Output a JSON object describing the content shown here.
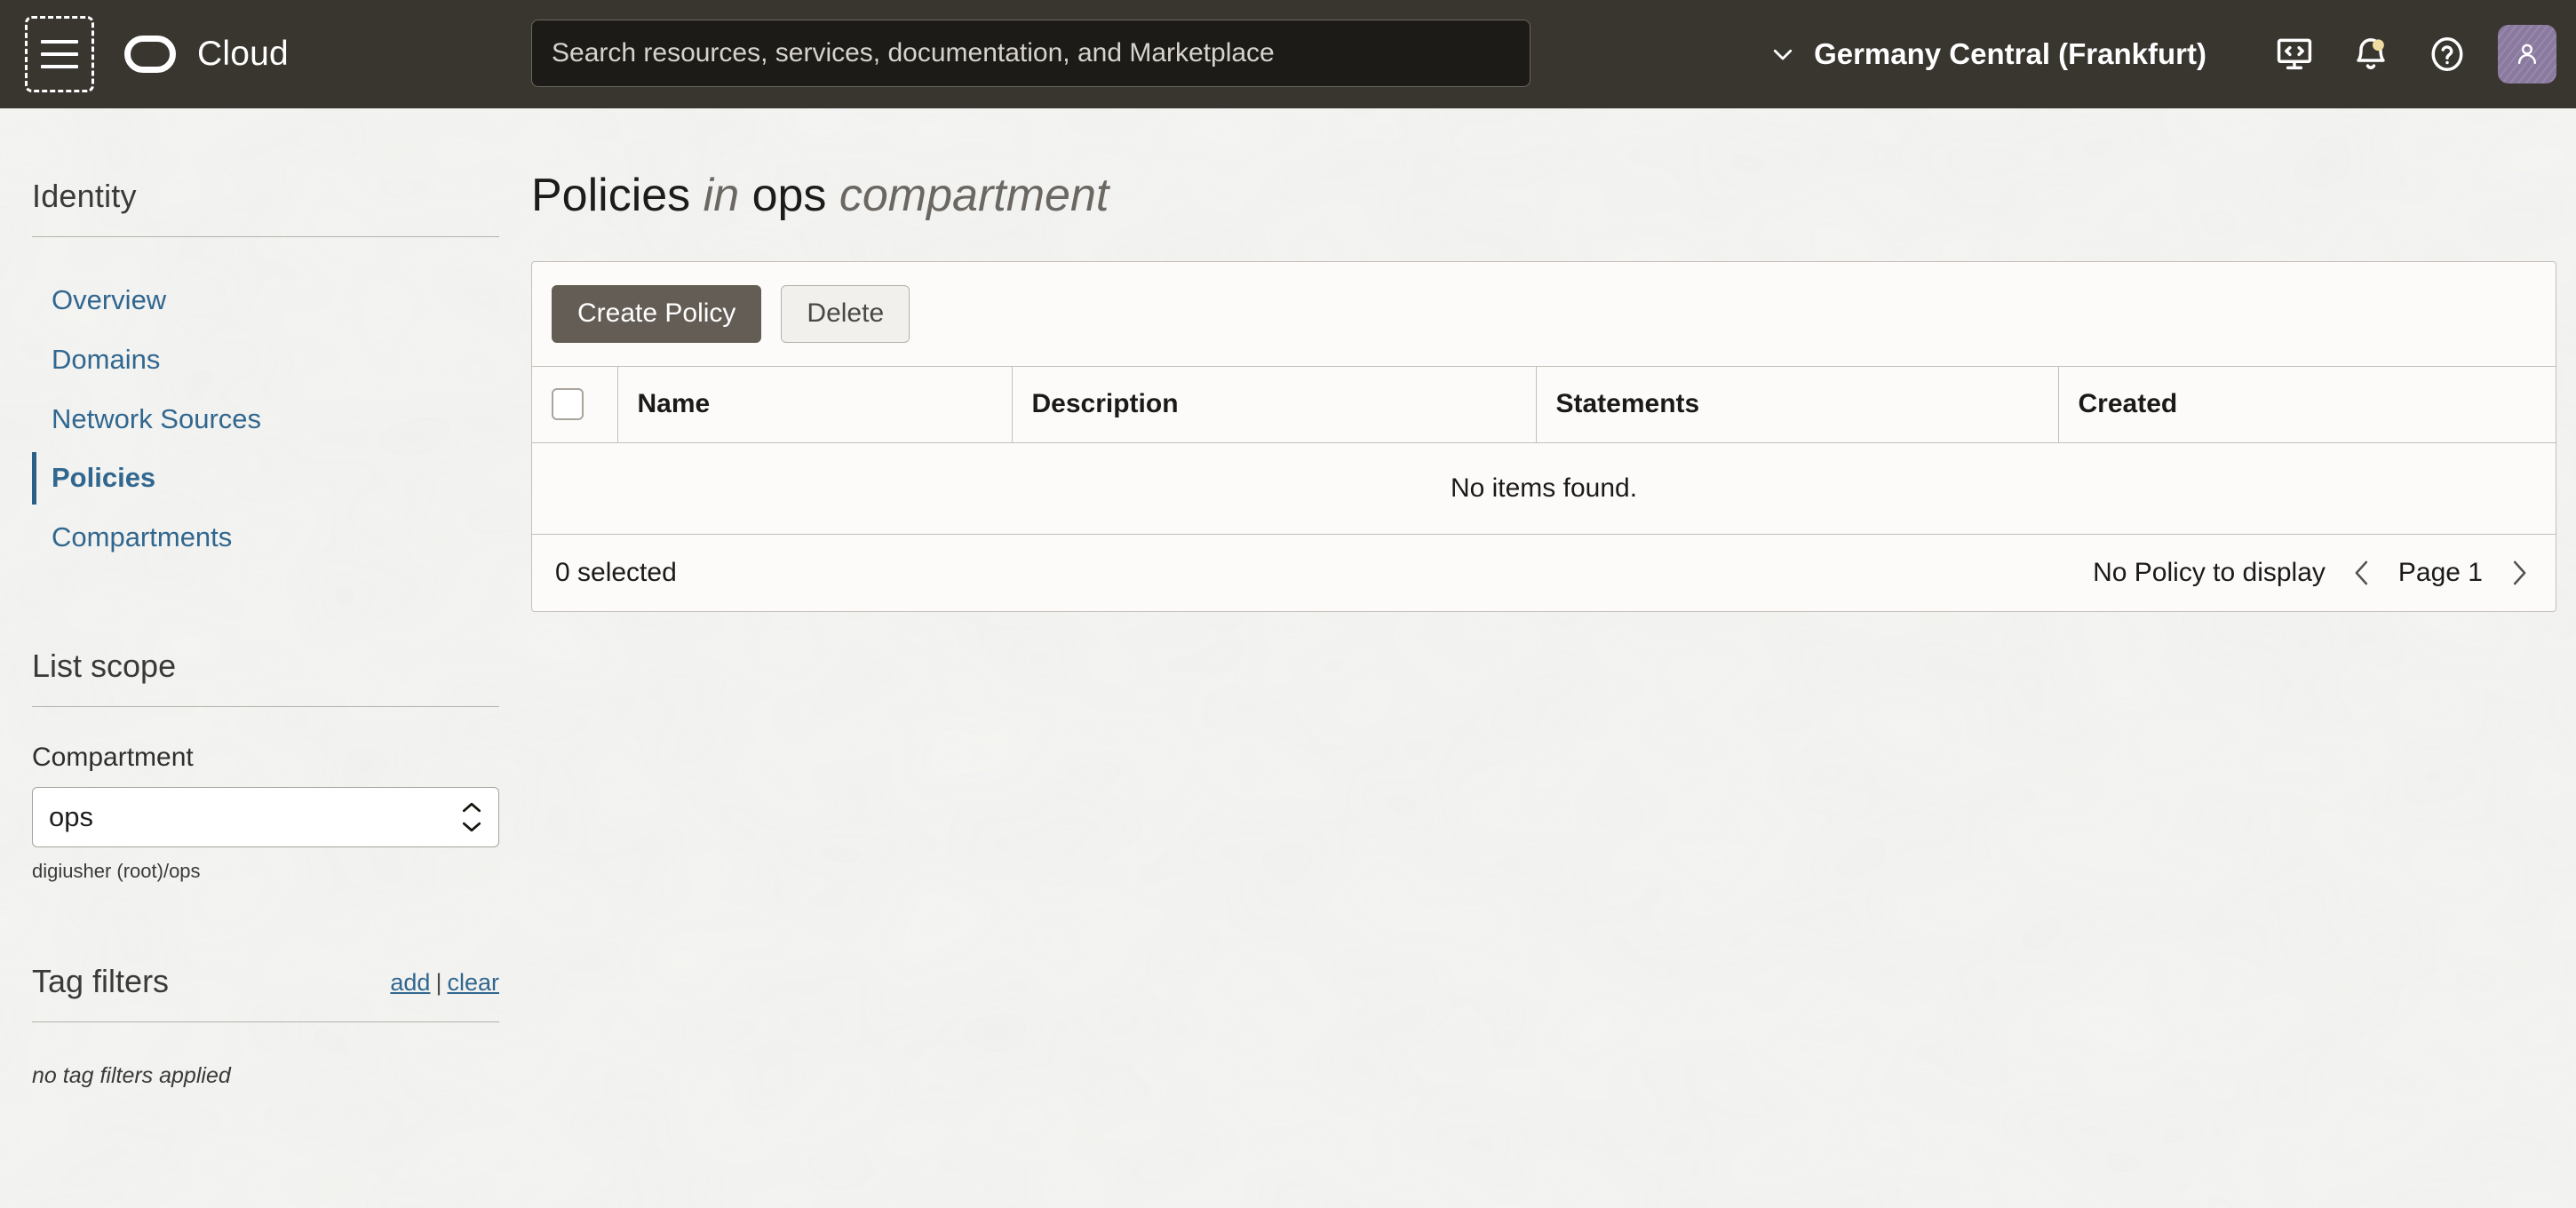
{
  "topbar": {
    "menu_icon": "hamburger-menu-icon",
    "brand_logo_icon": "cloud-logo-icon",
    "brand_label": "Cloud",
    "search": {
      "placeholder": "Search resources, services, documentation, and Marketplace",
      "value": ""
    },
    "region": {
      "chevron_icon": "chevron-down-icon",
      "label": "Germany Central (Frankfurt)"
    },
    "actions": [
      {
        "icon": "cloud-shell-icon",
        "label": "Cloud Shell"
      },
      {
        "icon": "notification-bell-icon",
        "label": "Notifications",
        "badge": true
      },
      {
        "icon": "help-question-icon",
        "label": "Help"
      }
    ],
    "avatar": {
      "icon": "user-avatar-icon",
      "color": "#8b7aa0"
    }
  },
  "sidebar": {
    "service_heading": "Identity",
    "items": [
      {
        "label": "Overview",
        "active": false
      },
      {
        "label": "Domains",
        "active": false
      },
      {
        "label": "Network Sources",
        "active": false
      },
      {
        "label": "Policies",
        "active": true
      },
      {
        "label": "Compartments",
        "active": false
      }
    ],
    "list_scope": {
      "heading": "List scope",
      "compartment_label": "Compartment",
      "compartment_value": "ops",
      "compartment_path": "digiusher (root)/ops",
      "stepper_icon": "up-down-chevron-icon"
    },
    "tag_filters": {
      "heading": "Tag filters",
      "add_label": "add",
      "separator": "|",
      "clear_label": "clear",
      "empty_text": "no tag filters applied"
    }
  },
  "main": {
    "title": {
      "resource": "Policies",
      "in_word": "in",
      "compartment": "ops",
      "compartment_word": "compartment"
    },
    "toolbar": {
      "create_label": "Create Policy",
      "delete_label": "Delete"
    },
    "table": {
      "select_all_icon": "checkbox-icon",
      "columns": [
        "Name",
        "Description",
        "Statements",
        "Created"
      ],
      "rows": [],
      "empty_message": "No items found."
    },
    "footer": {
      "selected_text": "0 selected",
      "display_status": "No Policy to display",
      "prev_icon": "chevron-left-icon",
      "page_label": "Page 1",
      "next_icon": "chevron-right-icon"
    }
  },
  "theme": {
    "topbar_bg": "#393630",
    "page_bg": "#eeeeec",
    "link_blue": "#31678f",
    "active_blue": "#2a5f87",
    "primary_button_bg": "#645d55",
    "card_bg": "#fcfbfa",
    "border_gray": "#c4c0b8",
    "badge_yellow": "#f0dca0"
  }
}
